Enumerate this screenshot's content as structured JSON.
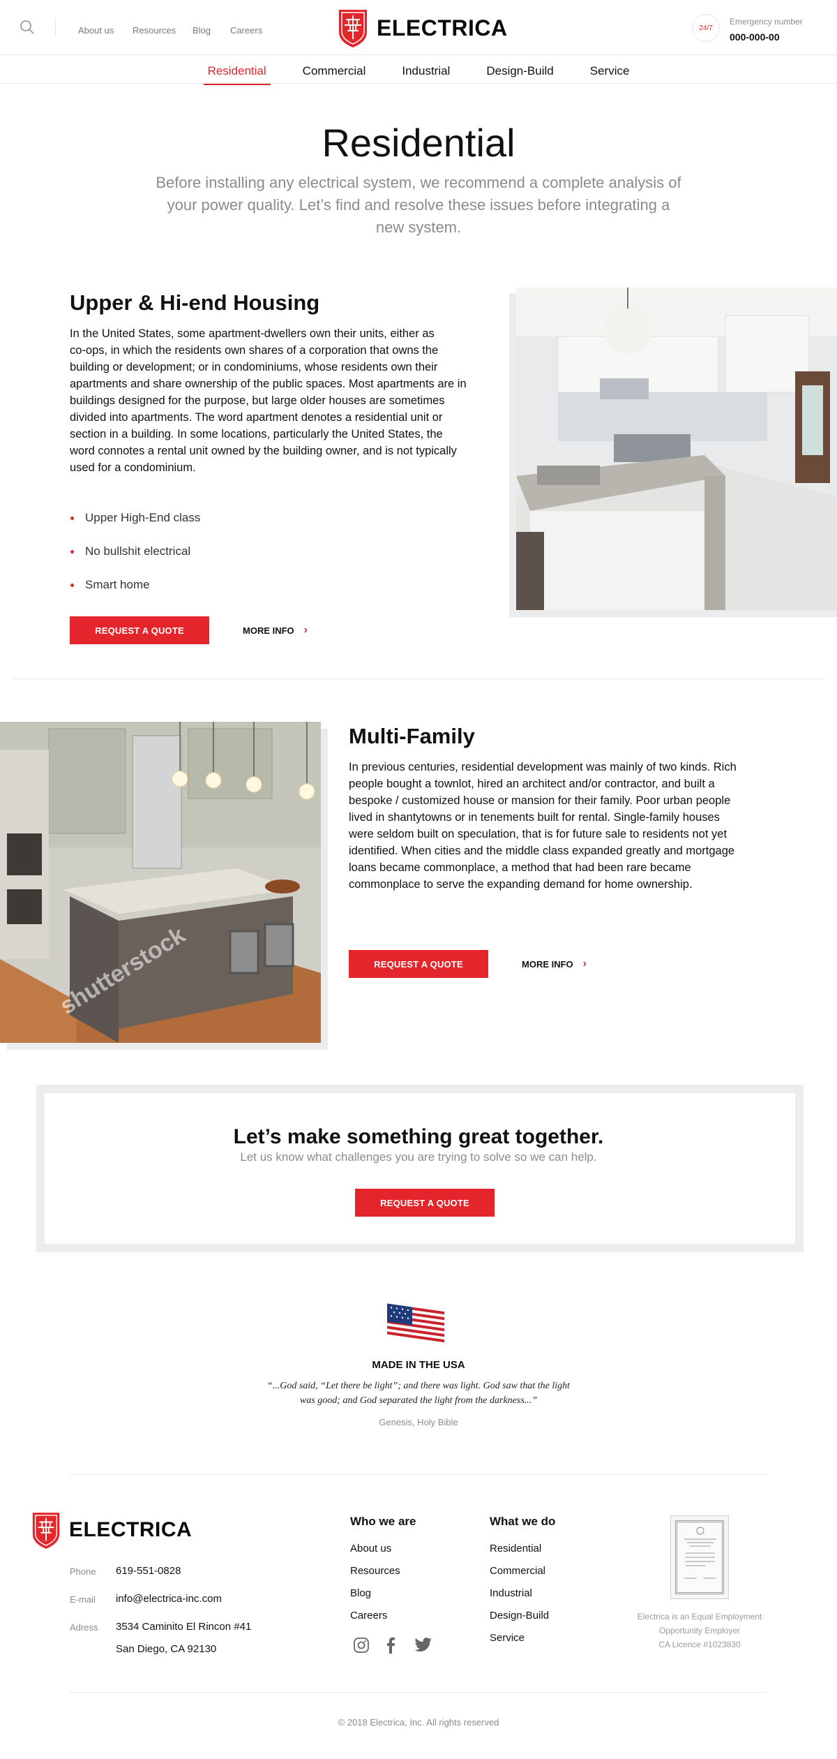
{
  "header": {
    "nav": [
      "About us",
      "Resources",
      "Blog",
      "Careers"
    ],
    "brand": "ELECTRICA",
    "badge": "24/7",
    "emergency_label": "Emergency number",
    "emergency_number": "000-000-00"
  },
  "subnav": {
    "tabs": [
      "Residential",
      "Commercial",
      "Industrial",
      "Design-Build",
      "Service"
    ],
    "active": "Residential"
  },
  "hero": {
    "title": "Residential",
    "subtitle_lines": [
      "Before installing any electrical system, we recommend a complete analysis of",
      "your power quality. Let’s find and resolve these issues before integrating a",
      "new system."
    ]
  },
  "section1": {
    "title": "Upper & Hi-end Housing",
    "body_lines": [
      "In the United States, some apartment-dwellers own their units, either as",
      "co-ops, in which the residents own shares of a corporation that owns the",
      "building or development; or in condominiums, whose residents own their",
      "apartments and share ownership of the public spaces. Most apartments are in",
      "buildings designed for the purpose, but large older houses are sometimes",
      "divided into apartments. The word apartment denotes a residential unit or",
      "section in a building. In some locations, particularly the United States, the",
      "word connotes a rental unit owned by the building owner, and is not typically",
      "used for a condominium."
    ],
    "bullets": [
      "Upper High-End class",
      "No bullshit electrical",
      "Smart home"
    ],
    "cta": "REQUEST A QUOTE",
    "more": "MORE INFO"
  },
  "section2": {
    "title": "Multi-Family",
    "body_lines": [
      "In previous centuries, residential development was mainly of two kinds. Rich",
      "people bought a townlot, hired an architect and/or contractor, and built a",
      "bespoke / customized house or mansion for their family. Poor urban people",
      "lived in shantytowns or in tenements built for rental. Single-family houses",
      "were seldom built on speculation, that is for future sale to residents not yet",
      "identified. When cities and the middle class expanded greatly and mortgage",
      "loans became commonplace, a method that had been rare became",
      "commonplace to serve the expanding demand for home ownership."
    ],
    "watermark": "shutterstock",
    "cta": "REQUEST A QUOTE",
    "more": "MORE INFO"
  },
  "cta_box": {
    "title": "Let’s make something great together.",
    "subtitle": "Let us know what challenges you are trying to solve so we can help.",
    "button": "REQUEST A QUOTE"
  },
  "usa": {
    "label": "MADE IN THE USA",
    "quote_lines": [
      "“...God said, “Let there be light”; and there was light. God saw that the light",
      "was good; and God separated the light from the darkness...”"
    ],
    "source": "Genesis, Holy Bible"
  },
  "footer": {
    "brand": "ELECTRICA",
    "phone_label": "Phone",
    "phone": "619-551-0828",
    "email_label": "E-mail",
    "email": "info@electrica-inc.com",
    "address_label": "Adress",
    "address_line1": "3534 Caminito El Rincon #41",
    "address_line2": "San Diego, CA 92130",
    "who_title": "Who we are",
    "who_links": [
      "About us",
      "Resources",
      "Blog",
      "Careers"
    ],
    "what_title": "What we do",
    "what_links": [
      "Residential",
      "Commercial",
      "Industrial",
      "Design-Build",
      "Service"
    ],
    "equal_lines": [
      "Electrica is an Equal Employment",
      "Opportunity Employer",
      "CA Licence #1023830"
    ],
    "copyright": "© 2018 Electrica, Inc. All rights reserved"
  },
  "colors": {
    "accent": "#e4262c",
    "text": "#111111",
    "muted": "#8b8b8b",
    "divider": "#e8e8e8"
  }
}
